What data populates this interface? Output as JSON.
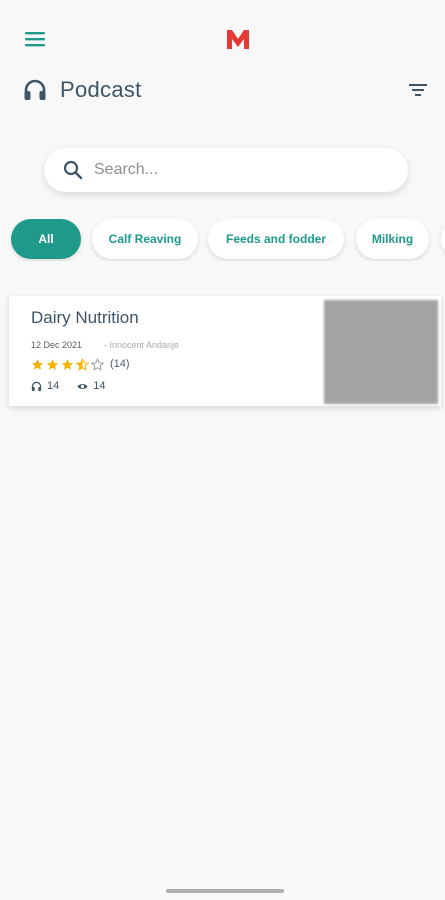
{
  "header": {
    "menu_icon": "hamburger-menu-icon",
    "logo_letter": "M",
    "logo_color": "#e53935",
    "title": "Podcast",
    "title_icon": "headphones-icon",
    "filter_icon": "filter-icon"
  },
  "search": {
    "placeholder": "Search...",
    "value": ""
  },
  "categories": [
    {
      "label": "All",
      "active": true
    },
    {
      "label": "Calf Reaving",
      "active": false
    },
    {
      "label": "Feeds and fodder",
      "active": false
    },
    {
      "label": "Milking",
      "active": false
    }
  ],
  "podcasts": [
    {
      "title": "Dairy Nutrition",
      "date": "12 Dec 2021",
      "author": "- Innocent Andanje",
      "rating": 3.5,
      "rating_max": 5,
      "rating_count": "(14)",
      "listens": "14",
      "views": "14"
    }
  ],
  "colors": {
    "accent": "#1f9a8a",
    "star": "#f5b301",
    "text": "#3d5566",
    "background": "#f8f8f8"
  }
}
